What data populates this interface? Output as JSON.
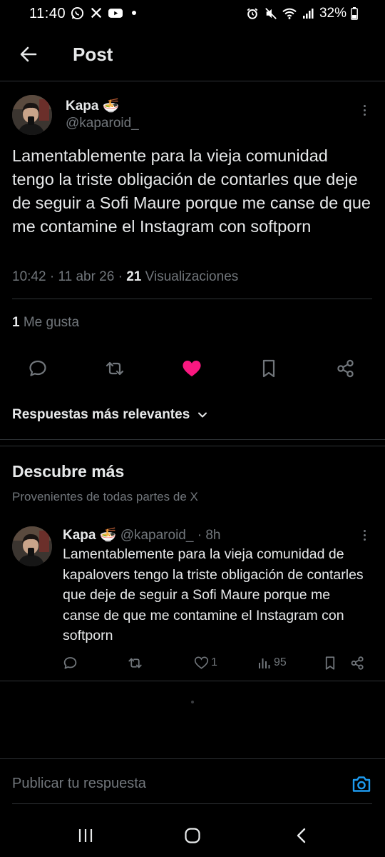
{
  "status_bar": {
    "time": "11:40",
    "battery": "32%",
    "left_icons": [
      "whatsapp-icon",
      "x-icon",
      "youtube-icon"
    ],
    "right_icons": [
      "alarm-icon",
      "mute-icon",
      "wifi-icon",
      "signal-icon",
      "battery-icon"
    ]
  },
  "header": {
    "title": "Post"
  },
  "main_tweet": {
    "author_name": "Kapa 🍜",
    "author_handle": "@kaparoid_",
    "text": "Lamentablemente para la vieja comunidad tengo la triste obligación de contarles que deje de seguir a Sofi Maure porque me canse de que me contamine el Instagram con softporn",
    "time": "10:42",
    "date": "11 abr 26",
    "views_count": "21",
    "views_label": "Visualizaciones",
    "likes_count": "1",
    "likes_label": "Me gusta",
    "liked": true
  },
  "replies_sort": {
    "label": "Respuestas más relevantes"
  },
  "discover": {
    "title": "Descubre más",
    "subtitle": "Provenientes de todas partes de X",
    "tweet": {
      "author_name": "Kapa 🍜",
      "author_handle": "@kaparoid_",
      "age": "8h",
      "text": "Lamentablemente para la vieja comunidad de kapalovers tengo la triste obligación de contarles que deje de seguir a Sofi Maure porque me canse de que me contamine el Instagram con softporn",
      "likes": "1",
      "views": "95"
    }
  },
  "reply_bar": {
    "placeholder": "Publicar tu respuesta"
  },
  "colors": {
    "background": "#000000",
    "text": "#e7e9ea",
    "muted": "#71767b",
    "like_pink": "#f91880",
    "accent_blue": "#1d9bf0",
    "divider": "#2f3336"
  }
}
